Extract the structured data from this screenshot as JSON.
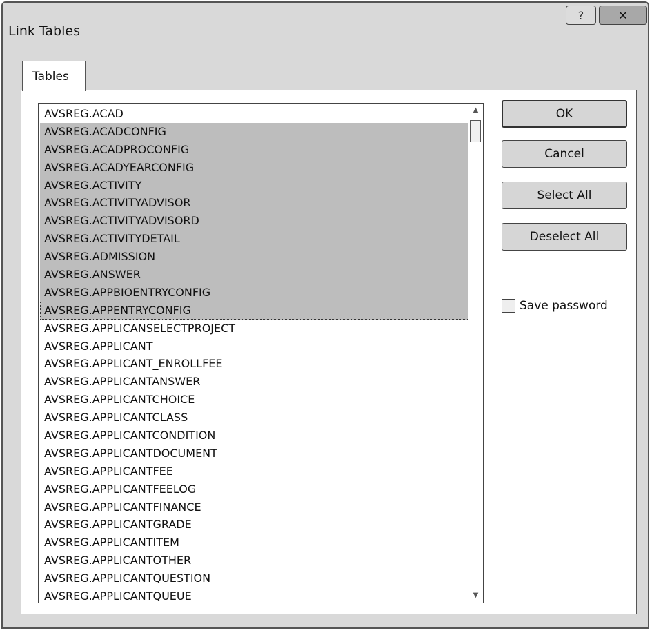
{
  "window": {
    "title": "Link Tables",
    "help_glyph": "?",
    "close_glyph": "✕"
  },
  "tabs": [
    {
      "label": "Tables"
    }
  ],
  "tables_list": {
    "items": [
      {
        "label": "AVSREG.ACAD",
        "selected": false
      },
      {
        "label": "AVSREG.ACADCONFIG",
        "selected": true
      },
      {
        "label": "AVSREG.ACADPROCONFIG",
        "selected": true
      },
      {
        "label": "AVSREG.ACADYEARCONFIG",
        "selected": true
      },
      {
        "label": "AVSREG.ACTIVITY",
        "selected": true
      },
      {
        "label": "AVSREG.ACTIVITYADVISOR",
        "selected": true
      },
      {
        "label": "AVSREG.ACTIVITYADVISORD",
        "selected": true
      },
      {
        "label": "AVSREG.ACTIVITYDETAIL",
        "selected": true
      },
      {
        "label": "AVSREG.ADMISSION",
        "selected": true
      },
      {
        "label": "AVSREG.ANSWER",
        "selected": true
      },
      {
        "label": "AVSREG.APPBIOENTRYCONFIG",
        "selected": true
      },
      {
        "label": "AVSREG.APPENTRYCONFIG",
        "selected": true
      },
      {
        "label": "AVSREG.APPLICANSELECTPROJECT",
        "selected": false
      },
      {
        "label": "AVSREG.APPLICANT",
        "selected": false
      },
      {
        "label": "AVSREG.APPLICANT_ENROLLFEE",
        "selected": false
      },
      {
        "label": "AVSREG.APPLICANTANSWER",
        "selected": false
      },
      {
        "label": "AVSREG.APPLICANTCHOICE",
        "selected": false
      },
      {
        "label": "AVSREG.APPLICANTCLASS",
        "selected": false
      },
      {
        "label": "AVSREG.APPLICANTCONDITION",
        "selected": false
      },
      {
        "label": "AVSREG.APPLICANTDOCUMENT",
        "selected": false
      },
      {
        "label": "AVSREG.APPLICANTFEE",
        "selected": false
      },
      {
        "label": "AVSREG.APPLICANTFEELOG",
        "selected": false
      },
      {
        "label": "AVSREG.APPLICANTFINANCE",
        "selected": false
      },
      {
        "label": "AVSREG.APPLICANTGRADE",
        "selected": false
      },
      {
        "label": "AVSREG.APPLICANTITEM",
        "selected": false
      },
      {
        "label": "AVSREG.APPLICANTOTHER",
        "selected": false
      },
      {
        "label": "AVSREG.APPLICANTQUESTION",
        "selected": false
      },
      {
        "label": "AVSREG.APPLICANTQUEUE",
        "selected": false
      }
    ],
    "focused_item": "AVSREG.APPENTRYCONFIG"
  },
  "buttons": {
    "ok": "OK",
    "cancel": "Cancel",
    "select_all": "Select All",
    "deselect_all": "Deselect All"
  },
  "save_password": {
    "label": "Save password",
    "checked": false
  },
  "icons": {
    "scroll_up": "up-arrow",
    "scroll_down": "down-arrow"
  },
  "colors": {
    "selection": "#bdbdbd",
    "dialog_bg": "#d9d9d9"
  }
}
